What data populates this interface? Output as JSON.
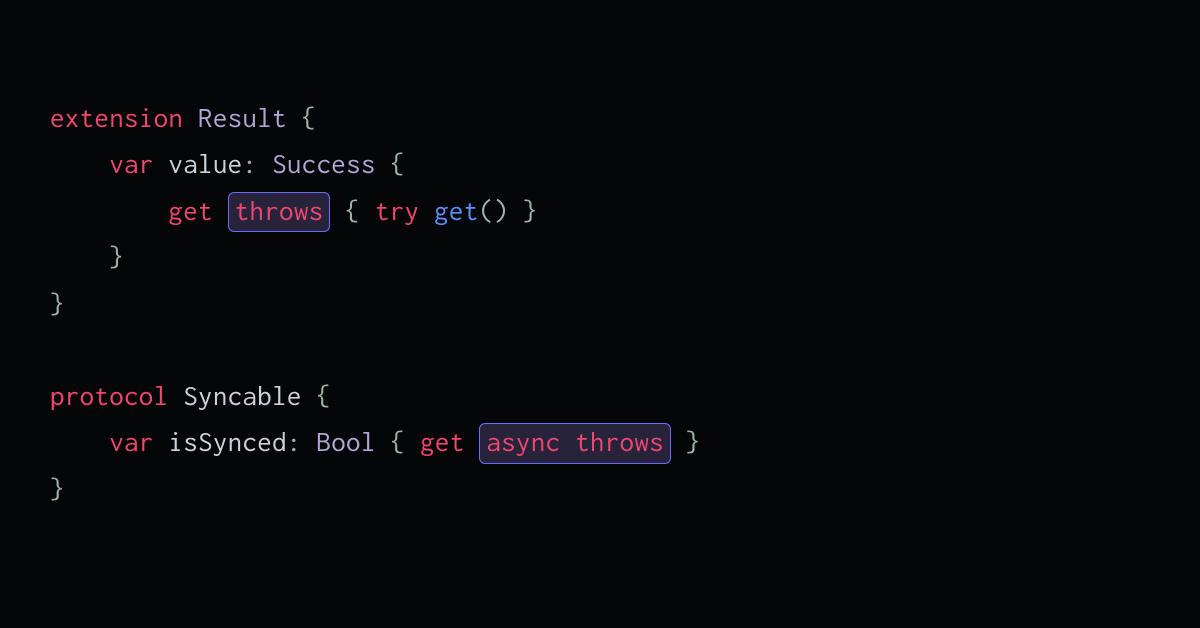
{
  "code": {
    "line1": {
      "kw_extension": "extension",
      "type_result": "Result",
      "brace_open": "{"
    },
    "line2": {
      "kw_var": "var",
      "ident_value": "value",
      "colon": ":",
      "type_success": "Success",
      "brace_open": "{"
    },
    "line3": {
      "kw_get": "get",
      "hl_throws": "throws",
      "brace_open": "{",
      "kw_try": "try",
      "fn_get": "get",
      "parens": "()",
      "brace_close": "}"
    },
    "line4": {
      "brace_close": "}"
    },
    "line5": {
      "brace_close": "}"
    },
    "line6": {
      "kw_protocol": "protocol",
      "type_syncable": "Syncable",
      "brace_open": "{"
    },
    "line7": {
      "kw_var": "var",
      "ident_issynced": "isSynced",
      "colon": ":",
      "type_bool": "Bool",
      "brace_open": "{",
      "kw_get": "get",
      "hl_async_throws": "async throws",
      "brace_close": "}"
    },
    "line8": {
      "brace_close": "}"
    }
  }
}
